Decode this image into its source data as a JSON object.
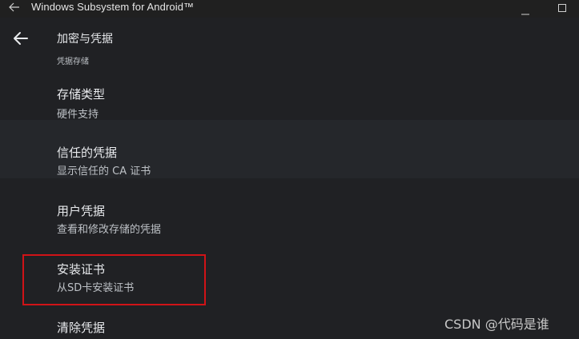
{
  "window": {
    "title": "Windows Subsystem for Android™"
  },
  "appbar": {
    "title": "加密与凭据"
  },
  "section": {
    "header": "凭据存储"
  },
  "items": [
    {
      "title": "存储类型",
      "subtitle": "硬件支持"
    },
    {
      "title": "信任的凭据",
      "subtitle": "显示信任的 CA 证书"
    },
    {
      "title": "用户凭据",
      "subtitle": "查看和修改存储的凭据"
    },
    {
      "title": "安装证书",
      "subtitle": "从SD卡安装证书"
    },
    {
      "title": "清除凭据",
      "subtitle": ""
    }
  ],
  "watermark": "CSDN @代码是谁",
  "colors": {
    "background": "#202124",
    "titlebar": "#202020",
    "highlight": "#d01317"
  }
}
